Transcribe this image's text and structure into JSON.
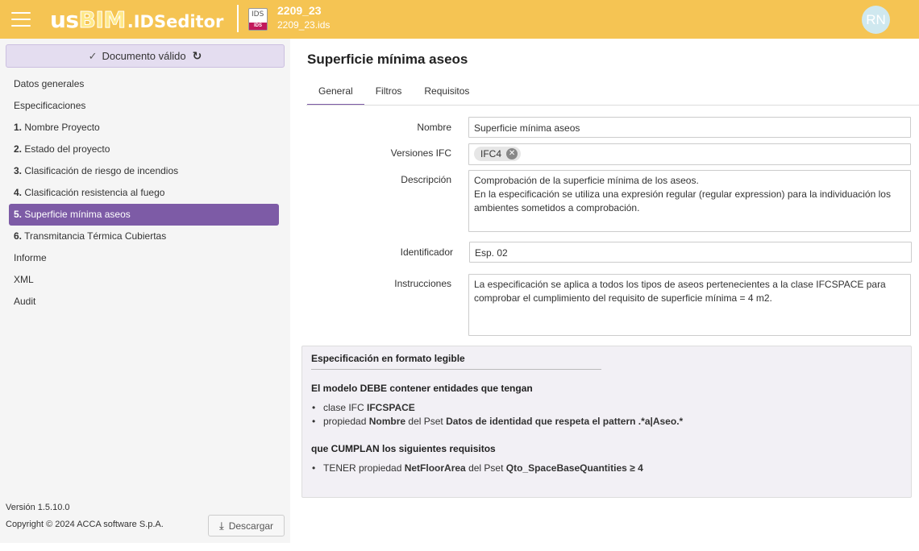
{
  "header": {
    "logo_us": "us",
    "logo_bim": "BIM",
    "logo_ids": ".IDSeditor",
    "file_icon_top": "IDS",
    "file_icon_bottom": "IDS",
    "file_name": "2209_23",
    "file_path": "2209_23.ids",
    "avatar_initials": "RN",
    "accent_color": "#f5c453"
  },
  "sidebar": {
    "status_label": "Documento válido",
    "items": [
      {
        "num": "",
        "label": "Datos generales"
      },
      {
        "num": "",
        "label": "Especificaciones"
      },
      {
        "num": "1.",
        "label": "Nombre Proyecto"
      },
      {
        "num": "2.",
        "label": "Estado del proyecto"
      },
      {
        "num": "3.",
        "label": "Clasificación de riesgo de incendios"
      },
      {
        "num": "4.",
        "label": "Clasificación resistencia al fuego"
      },
      {
        "num": "5.",
        "label": "Superficie mínima aseos"
      },
      {
        "num": "6.",
        "label": "Transmitancia Térmica Cubiertas"
      },
      {
        "num": "",
        "label": "Informe"
      },
      {
        "num": "",
        "label": "XML"
      },
      {
        "num": "",
        "label": "Audit"
      }
    ],
    "active_index": 6,
    "version": "Versión 1.5.10.0",
    "copyright": "Copyright © 2024 ACCA software S.p.A.",
    "download_label": "Descargar",
    "active_color": "#7d5ba6"
  },
  "main": {
    "title": "Superficie mínima aseos",
    "tabs": [
      {
        "label": "General"
      },
      {
        "label": "Filtros"
      },
      {
        "label": "Requisitos"
      }
    ],
    "fields": {
      "nombre_label": "Nombre",
      "nombre_value": "Superficie mínima aseos",
      "versiones_label": "Versiones IFC",
      "versiones_chip": "IFC4",
      "descripcion_label": "Descripción",
      "descripcion_line1": "Comprobación de la superficie mínima de los aseos.",
      "descripcion_line2": "En la especificación se utiliza una expresión regular (regular expression) para la individuación los",
      "descripcion_line3": "ambientes sometidos a comprobación.",
      "identificador_label": "Identificador",
      "identificador_value": "Esp. 02",
      "instrucciones_label": "Instrucciones",
      "instrucciones_line1": "La especificación se aplica a todos los tipos de aseos pertenecientes a la clase IFCSPACE para",
      "instrucciones_line2": "comprobar el cumplimiento del requisito de superficie mínima = 4 m2."
    },
    "summary": {
      "title": "Especificación en formato legible",
      "applicability_heading": "El modelo DEBE contener entidades que tengan",
      "app1_pre": "clase IFC ",
      "app1_bold": "IFCSPACE",
      "app2_pre": "propiedad ",
      "app2_bold1": "Nombre",
      "app2_mid": " del Pset ",
      "app2_bold2": "Datos de identidad que respeta el pattern .*a|Aseo.*",
      "requirements_heading": "que CUMPLAN los siguientes requisitos",
      "req1_pre": "TENER propiedad ",
      "req1_bold1": "NetFloorArea",
      "req1_mid": " del Pset ",
      "req1_bold2": "Qto_SpaceBaseQuantities ≥ 4"
    }
  }
}
